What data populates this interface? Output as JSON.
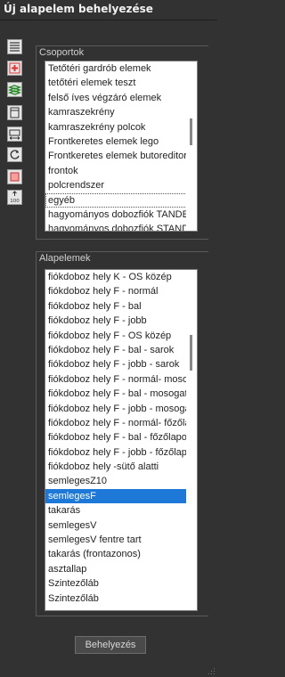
{
  "window": {
    "title": "Új alapelem behelyezése"
  },
  "toolbar": {
    "icons": [
      "list-view-icon",
      "add-icon",
      "layers-icon",
      "panel-icon",
      "resize-icon",
      "rotate-icon",
      "color-icon",
      "scale-icon"
    ],
    "scale_label": "100"
  },
  "groups": {
    "label": "Csoportok",
    "items": [
      "Tetőtéri gardrób elemek",
      "tetőtéri elemek teszt",
      "felső íves végzáró elemek",
      "kamraszekrény",
      "kamraszekrény polcok",
      "Frontkeretes elemek lego",
      "Frontkeretes elemek butoreditor",
      "frontok",
      "polcrendszer",
      "egyéb",
      "hagyományos dobozfiók TANDEM",
      "hagyományos dobozfiók STANDARD"
    ],
    "selected_index": 9
  },
  "elements": {
    "label": "Alapelemek",
    "items": [
      "fiókdoboz hely K - OS közép",
      "fiókdoboz hely F - normál",
      "fiókdoboz hely F - bal",
      "fiókdoboz hely F - jobb",
      "fiókdoboz hely F - OS közép",
      "fiókdoboz hely F - bal - sarok",
      "fiókdoboz hely F - jobb - sarok",
      "fiókdoboz hely F - normál- mosogató",
      "fiókdoboz hely F - bal - mosogató",
      "fiókdoboz hely F - jobb - mosogató",
      "fiókdoboz hely F - normál- főzőlap",
      "fiókdoboz hely F - bal - főzőlapos",
      "fiókdoboz hely F - jobb - főzőlapos",
      "fiókdoboz hely -sütő alatti",
      "semlegesZ10",
      "semlegesF",
      "takarás",
      "semlegesV",
      "semlegesV fentre tart",
      "takarás (frontazonos)",
      "asztallap",
      "Szintezőláb",
      "Szintezőláb"
    ],
    "selected_index": 15
  },
  "actions": {
    "insert_label": "Behelyezés"
  }
}
